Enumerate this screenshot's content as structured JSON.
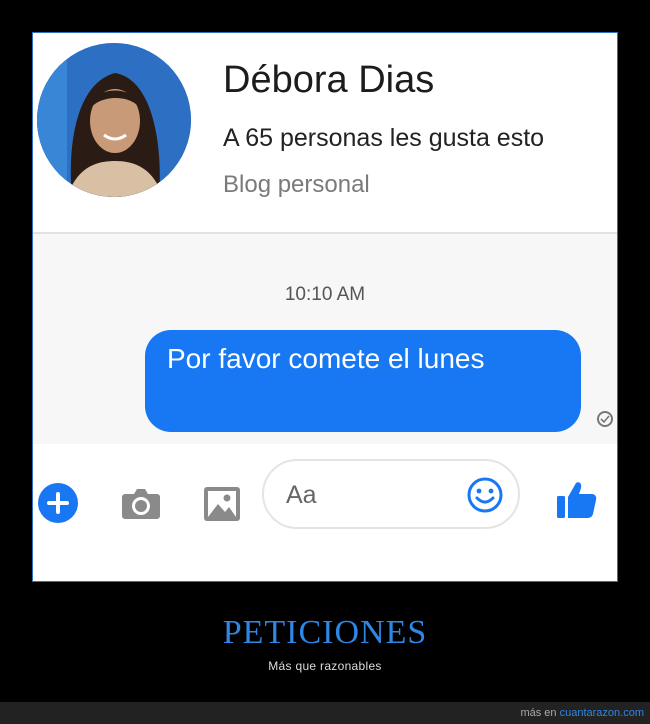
{
  "profile": {
    "name": "Débora Dias",
    "likes": "A 65 personas les gusta esto",
    "category": "Blog personal"
  },
  "conversation": {
    "timestamp": "10:10 AM",
    "messages": [
      {
        "text": "Por favor comete el lunes",
        "sender": "me",
        "status": "sent"
      }
    ]
  },
  "composer": {
    "placeholder": "Aa",
    "icons": [
      "plus-icon",
      "camera-icon",
      "image-icon",
      "emoji-icon",
      "thumbs-up-icon"
    ]
  },
  "meme": {
    "title": "PETICIONES",
    "subtitle": "Más que razonables",
    "credit_prefix": "más en",
    "credit_site": "cuantarazon.com"
  },
  "colors": {
    "accent": "#1877f2",
    "title": "#2f86e4",
    "background": "#000000"
  }
}
